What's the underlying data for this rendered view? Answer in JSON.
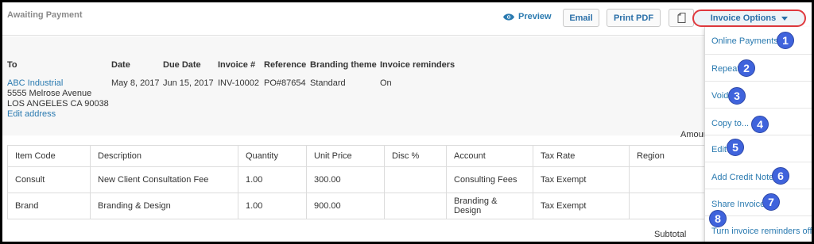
{
  "header": {
    "status": "Awaiting Payment",
    "preview_label": "Preview",
    "email_label": "Email",
    "print_label": "Print PDF",
    "options_label": "Invoice Options"
  },
  "info": {
    "to_label": "To",
    "date_label": "Date",
    "due_label": "Due Date",
    "invoice_label": "Invoice #",
    "reference_label": "Reference",
    "branding_label": "Branding theme",
    "reminders_label": "Invoice reminders",
    "customer_name": "ABC Industrial",
    "address_line1": "5555 Melrose Avenue",
    "address_line2": "LOS ANGELES CA 90038",
    "edit_address": "Edit address",
    "date": "May 8, 2017",
    "due_date": "Jun 15, 2017",
    "invoice_number": "INV-10002",
    "reference": "PO#87654",
    "branding": "Standard",
    "reminders": "On",
    "amount_label": "Amour"
  },
  "table": {
    "headers": [
      "Item Code",
      "Description",
      "Quantity",
      "Unit Price",
      "Disc %",
      "Account",
      "Tax Rate",
      "Region"
    ],
    "rows": [
      [
        "Consult",
        "New Client Consultation Fee",
        "1.00",
        "300.00",
        "",
        "Consulting Fees",
        "Tax Exempt",
        ""
      ],
      [
        "Brand",
        "Branding & Design",
        "1.00",
        "900.00",
        "",
        "Branding & Design",
        "Tax Exempt",
        ""
      ]
    ],
    "subtotal_label": "Subtotal"
  },
  "menu": {
    "items": [
      {
        "label": "Online Payments",
        "badge": "1"
      },
      {
        "label": "Repeat",
        "badge": "2"
      },
      {
        "label": "Void",
        "badge": "3"
      },
      {
        "label": "Copy to...",
        "badge": "4"
      },
      {
        "label": "Edit",
        "badge": "5"
      },
      {
        "label": "Add Credit Note",
        "badge": "6"
      },
      {
        "label": "Share Invoice",
        "badge": "7"
      },
      {
        "label": "Turn invoice reminders off",
        "badge": "8"
      }
    ]
  },
  "colors": {
    "link": "#2a7ab0",
    "annotation_badge": "#3f63dc",
    "highlight_ring": "#e0393e"
  }
}
